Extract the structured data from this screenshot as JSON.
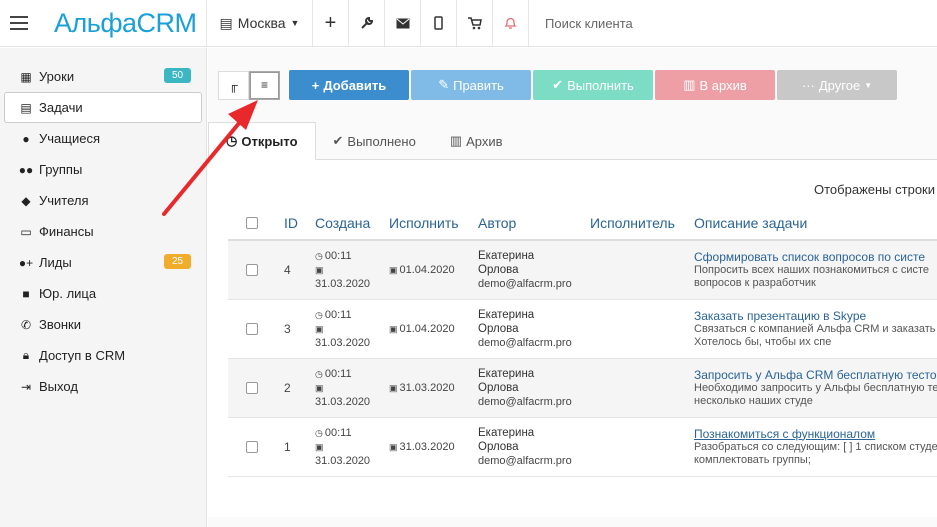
{
  "topbar": {
    "logo": "АльфаCRM",
    "city": "Москва",
    "search_label": "Поиск клиента"
  },
  "sidebar": {
    "items": [
      {
        "label": "Уроки",
        "icon": "calendar-icon",
        "badge": "50",
        "badge_color": "#3db6c4"
      },
      {
        "label": "Задачи",
        "icon": "clipboard-icon"
      },
      {
        "label": "Учащиеся",
        "icon": "user-icon"
      },
      {
        "label": "Группы",
        "icon": "users-icon"
      },
      {
        "label": "Учителя",
        "icon": "graduation-cap-icon"
      },
      {
        "label": "Финансы",
        "icon": "money-icon"
      },
      {
        "label": "Лиды",
        "icon": "user-plus-icon",
        "badge": "25",
        "badge_color": "#f0ad2c"
      },
      {
        "label": "Юр. лица",
        "icon": "briefcase-icon"
      },
      {
        "label": "Звонки",
        "icon": "phone-icon"
      },
      {
        "label": "Доступ в CRM",
        "icon": "lock-icon"
      },
      {
        "label": "Выход",
        "icon": "sign-out-icon"
      }
    ]
  },
  "toolbar": {
    "add": "Добавить",
    "edit": "Править",
    "complete": "Выполнить",
    "archive": "В архив",
    "other": "Другое"
  },
  "tabs": [
    {
      "label": "Открыто",
      "icon": "clock-icon"
    },
    {
      "label": "Выполнено",
      "icon": "check-icon"
    },
    {
      "label": "Архив",
      "icon": "trash-icon"
    }
  ],
  "rows_info": "Отображены строки",
  "table": {
    "headers": [
      "ID",
      "Создана",
      "Исполнить",
      "Автор",
      "Исполнитель",
      "Описание задачи"
    ],
    "rows": [
      {
        "id": "4",
        "created_time": "00:11",
        "created_date": "31.03.2020",
        "due": "01.04.2020",
        "author_first": "Екатерина",
        "author_last": "Орлова",
        "author_email": "demo@alfacrm.pro",
        "title": "Сформировать список вопросов по систе",
        "desc1": "Попросить всех наших познакомиться с систе",
        "desc2": "вопросов к разработчик"
      },
      {
        "id": "3",
        "created_time": "00:11",
        "created_date": "31.03.2020",
        "due": "01.04.2020",
        "author_first": "Екатерина",
        "author_last": "Орлова",
        "author_email": "demo@alfacrm.pro",
        "title": "Заказать презентацию в Skype",
        "desc1": "Связаться с компанией Альфа CRM и заказать п",
        "desc2": "Хотелось бы, чтобы их спе"
      },
      {
        "id": "2",
        "created_time": "00:11",
        "created_date": "31.03.2020",
        "due": "31.03.2020",
        "author_first": "Екатерина",
        "author_last": "Орлова",
        "author_email": "demo@alfacrm.pro",
        "title": "Запросить у Альфа CRM бесплатную тесто",
        "desc1": "Необходимо запросить у Альфы бесплатную те",
        "desc2": "несколько наших студе"
      },
      {
        "id": "1",
        "created_time": "00:11",
        "created_date": "31.03.2020",
        "due": "31.03.2020",
        "author_first": "Екатерина",
        "author_last": "Орлова",
        "author_email": "demo@alfacrm.pro",
        "title": "Познакомиться с функционалом",
        "desc1": "Разобраться со следующим: [ ] 1 списком студе",
        "desc2": "комплектовать группы;"
      }
    ]
  },
  "colors": {
    "accent": "#3c8dcd",
    "link": "#2a6496",
    "arrow": "#e8282b"
  }
}
